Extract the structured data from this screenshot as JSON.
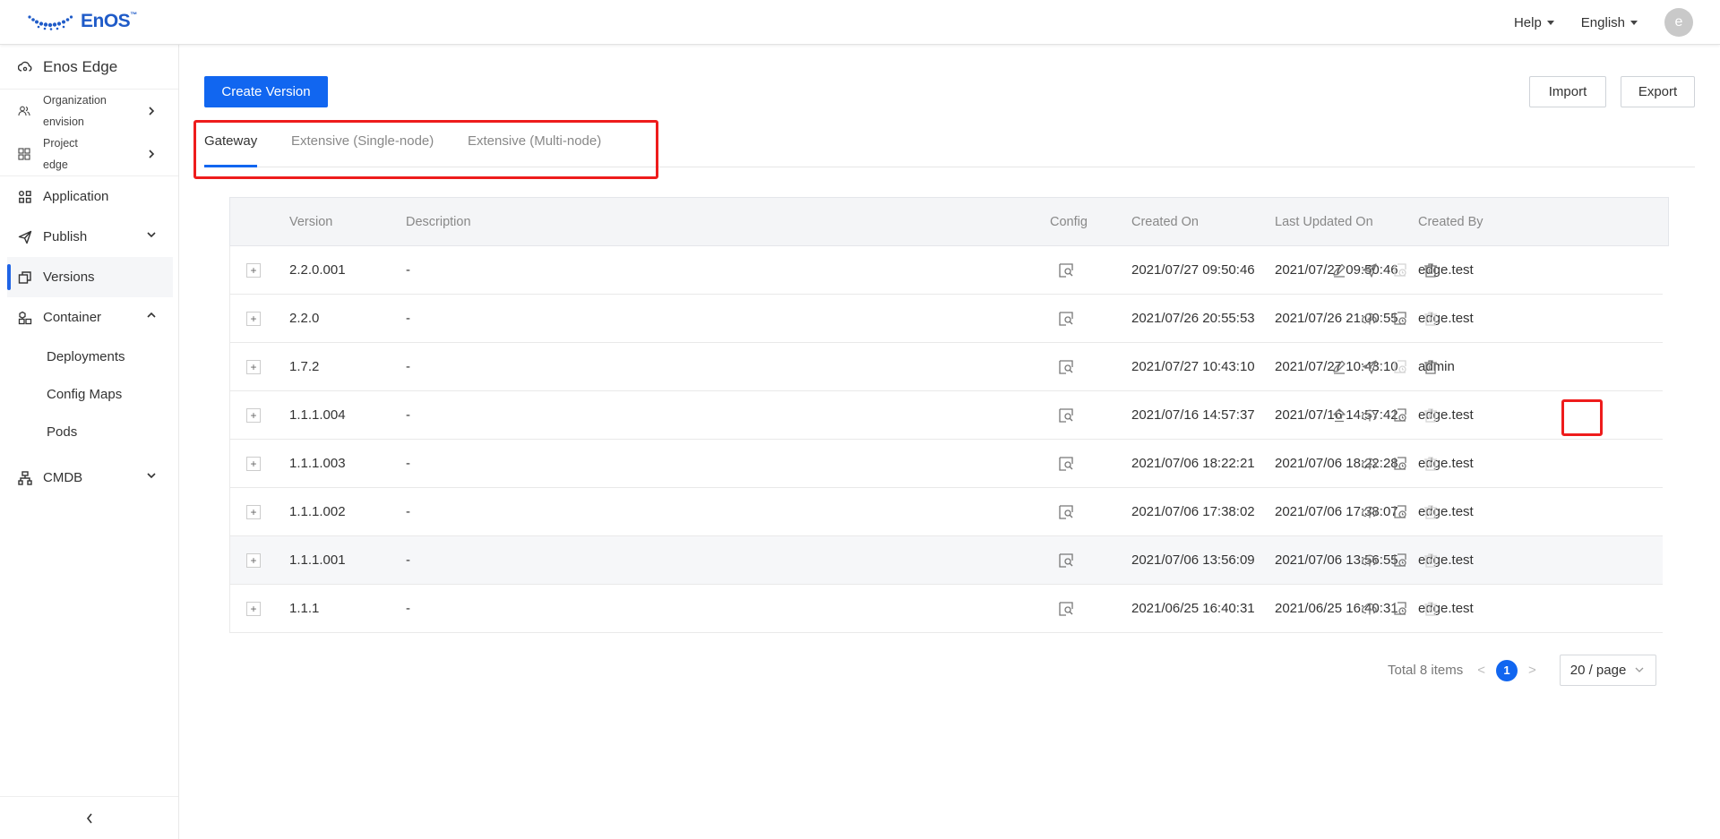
{
  "topbar": {
    "brand": "EnOS",
    "brand_tm": "™",
    "help_label": "Help",
    "language_label": "English",
    "avatar_letter": "e"
  },
  "sidebar": {
    "title": "Enos Edge",
    "organization": {
      "label": "Organization",
      "value": "envision"
    },
    "project": {
      "label": "Project",
      "value": "edge"
    },
    "items": [
      {
        "label": "Application",
        "icon": "grid-icon"
      },
      {
        "label": "Publish",
        "icon": "send-icon"
      },
      {
        "label": "Versions",
        "icon": "versions-icon"
      },
      {
        "label": "Container",
        "icon": "container-icon"
      },
      {
        "label": "CMDB",
        "icon": "tree-icon"
      }
    ],
    "container_sub": [
      "Deployments",
      "Config Maps",
      "Pods"
    ]
  },
  "toolbar": {
    "create_label": "Create Version",
    "import_label": "Import",
    "export_label": "Export"
  },
  "tabs": [
    "Gateway",
    "Extensive (Single-node)",
    "Extensive (Multi-node)"
  ],
  "table": {
    "columns": [
      "Version",
      "Description",
      "Config",
      "Created On",
      "Last Updated On",
      "Created By"
    ],
    "rows": [
      {
        "version": "2.2.0.001",
        "description": "-",
        "created": "2021/07/27 09:50:46",
        "updated": "2021/07/27 09:50:46",
        "by": "edge.test",
        "actions": [
          "edit",
          "publish",
          "rollback-disabled",
          "delete"
        ]
      },
      {
        "version": "2.2.0",
        "description": "-",
        "created": "2021/07/26 20:55:53",
        "updated": "2021/07/26 21:00:55",
        "by": "edge.test",
        "actions": [
          "download",
          "rollback",
          "delete-disabled"
        ]
      },
      {
        "version": "1.7.2",
        "description": "-",
        "created": "2021/07/27 10:43:10",
        "updated": "2021/07/27 10:43:10",
        "by": "admin",
        "actions": [
          "edit",
          "publish",
          "rollback-disabled",
          "delete"
        ]
      },
      {
        "version": "1.1.1.004",
        "description": "-",
        "created": "2021/07/16 14:57:37",
        "updated": "2021/07/16 14:57:42",
        "by": "edge.test",
        "actions": [
          "upload",
          "download",
          "rollback",
          "delete-disabled"
        ]
      },
      {
        "version": "1.1.1.003",
        "description": "-",
        "created": "2021/07/06 18:22:21",
        "updated": "2021/07/06 18:22:28",
        "by": "edge.test",
        "actions": [
          "download",
          "rollback",
          "delete-disabled"
        ]
      },
      {
        "version": "1.1.1.002",
        "description": "-",
        "created": "2021/07/06 17:38:02",
        "updated": "2021/07/06 17:38:07",
        "by": "edge.test",
        "actions": [
          "download",
          "rollback",
          "delete-disabled"
        ]
      },
      {
        "version": "1.1.1.001",
        "description": "-",
        "created": "2021/07/06 13:56:09",
        "updated": "2021/07/06 13:56:55",
        "by": "edge.test",
        "actions": [
          "download",
          "rollback",
          "delete-disabled"
        ]
      },
      {
        "version": "1.1.1",
        "description": "-",
        "created": "2021/06/25 16:40:31",
        "updated": "2021/06/25 16:40:31",
        "by": "edge.test",
        "actions": [
          "download",
          "rollback",
          "delete-disabled"
        ]
      }
    ]
  },
  "pagination": {
    "total_label": "Total 8 items",
    "current_page": "1",
    "page_size_label": "20 / page"
  },
  "colors": {
    "primary": "#1166f0",
    "highlight": "#ee1c1c",
    "brand": "#1f5bc8"
  }
}
